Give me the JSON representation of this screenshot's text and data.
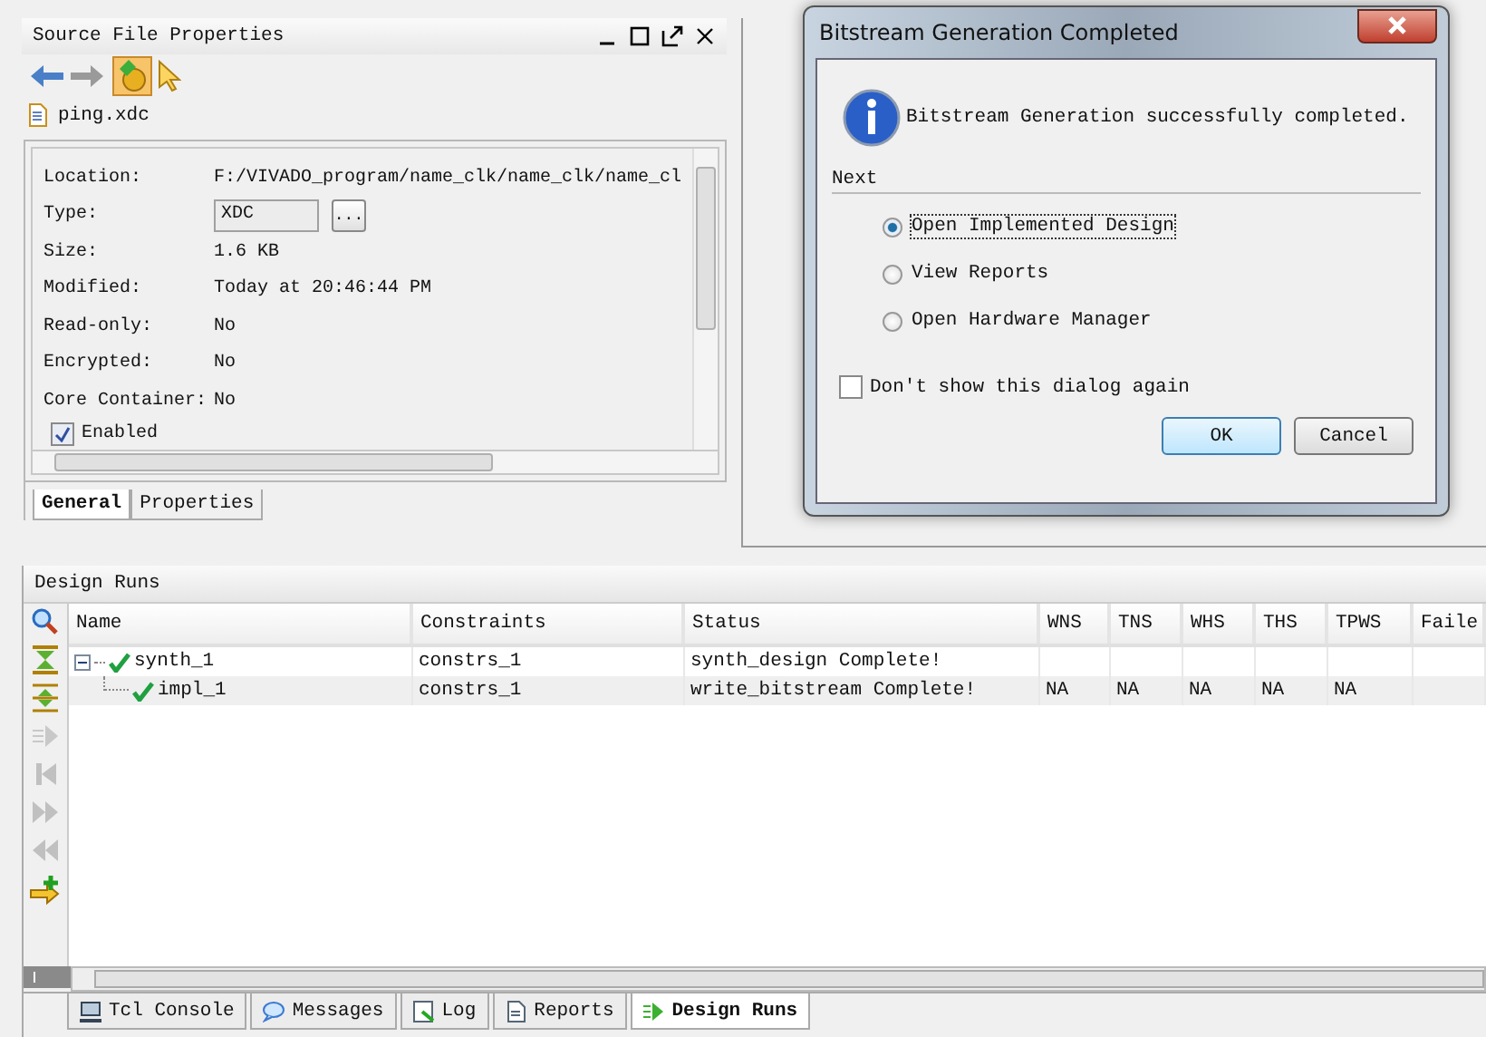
{
  "properties_panel": {
    "title": "Source File Properties",
    "file": "ping.xdc",
    "fields": [
      {
        "kind": "text",
        "label": "Location:",
        "value": "F:/VIVADO_program/name_clk/name_clk/name_cl"
      },
      {
        "kind": "combo",
        "label": "Type:",
        "value": "XDC",
        "button": "..."
      },
      {
        "kind": "text",
        "label": "Size:",
        "value": "1.6 KB"
      },
      {
        "kind": "text",
        "label": "Modified:",
        "value": "Today at 20:46:44 PM"
      },
      {
        "kind": "text",
        "label": "Read-only:",
        "value": "No"
      },
      {
        "kind": "text",
        "label": "Encrypted:",
        "value": "No"
      },
      {
        "kind": "text",
        "label": "Core Container:",
        "value": "No"
      }
    ],
    "enabled": {
      "label": "Enabled",
      "checked": true
    },
    "tabs": [
      {
        "label": "General",
        "selected": true
      },
      {
        "label": "Properties",
        "selected": false
      }
    ]
  },
  "dialog": {
    "title": "Bitstream Generation Completed",
    "message": "Bitstream Generation successfully completed.",
    "section": "Next",
    "options": [
      {
        "label": "Open Implemented Design",
        "selected": true
      },
      {
        "label": "View Reports",
        "selected": false
      },
      {
        "label": "Open Hardware Manager",
        "selected": false
      }
    ],
    "dont_show": {
      "label": "Don't show this dialog again",
      "checked": false
    },
    "buttons": [
      {
        "label": "OK",
        "default": true
      },
      {
        "label": "Cancel",
        "default": false
      }
    ]
  },
  "design_runs": {
    "title": "Design Runs",
    "columns": [
      "Name",
      "Constraints",
      "Status",
      "WNS",
      "TNS",
      "WHS",
      "THS",
      "TPWS",
      "Faile"
    ],
    "rows": [
      {
        "expanded": true,
        "cells": [
          "synth_1",
          "constrs_1",
          "synth_design Complete!",
          "",
          "",
          "",
          "",
          "",
          ""
        ],
        "children": [
          {
            "cells": [
              "impl_1",
              "constrs_1",
              "write_bitstream Complete!",
              "NA",
              "NA",
              "NA",
              "NA",
              "NA",
              ""
            ]
          }
        ]
      }
    ]
  },
  "bottom_tabs": [
    {
      "label": "Tcl Console",
      "selected": false
    },
    {
      "label": "Messages",
      "selected": false
    },
    {
      "label": "Log",
      "selected": false
    },
    {
      "label": "Reports",
      "selected": false
    },
    {
      "label": "Design Runs",
      "selected": true
    }
  ]
}
